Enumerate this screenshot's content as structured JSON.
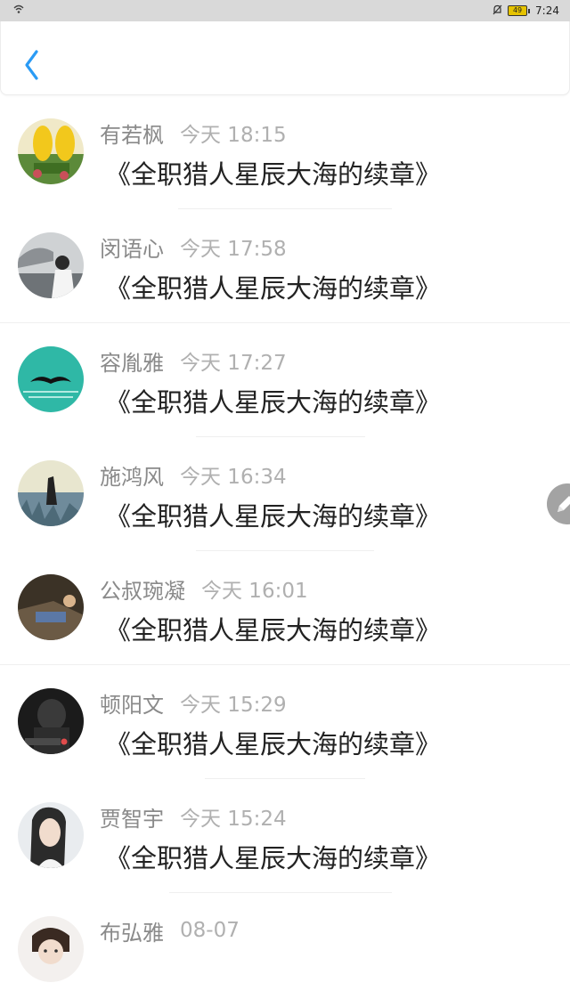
{
  "status_bar": {
    "time": "7:24",
    "battery_level": "49"
  },
  "colors": {
    "accent": "#2a9bf5",
    "name": "#8a8a8a",
    "time": "#b0b0b0",
    "message": "#222222"
  },
  "icons": {
    "back": "chevron-left-icon",
    "edit": "pencil-icon"
  },
  "comments": [
    {
      "name": "有若枫",
      "time": "今天 18:15",
      "message": "《全职猎人星辰大海的续章》"
    },
    {
      "name": "闵语心",
      "time": "今天 17:58",
      "message": "《全职猎人星辰大海的续章》"
    },
    {
      "name": "容胤雅",
      "time": "今天 17:27",
      "message": "《全职猎人星辰大海的续章》"
    },
    {
      "name": "施鸿风",
      "time": "今天 16:34",
      "message": "《全职猎人星辰大海的续章》"
    },
    {
      "name": "公叔琬凝",
      "time": "今天 16:01",
      "message": "《全职猎人星辰大海的续章》"
    },
    {
      "name": "顿阳文",
      "time": "今天 15:29",
      "message": "《全职猎人星辰大海的续章》"
    },
    {
      "name": "贾智宇",
      "time": "今天 15:24",
      "message": "《全职猎人星辰大海的续章》"
    },
    {
      "name": "布弘雅",
      "time": "08-07",
      "message": ""
    }
  ]
}
